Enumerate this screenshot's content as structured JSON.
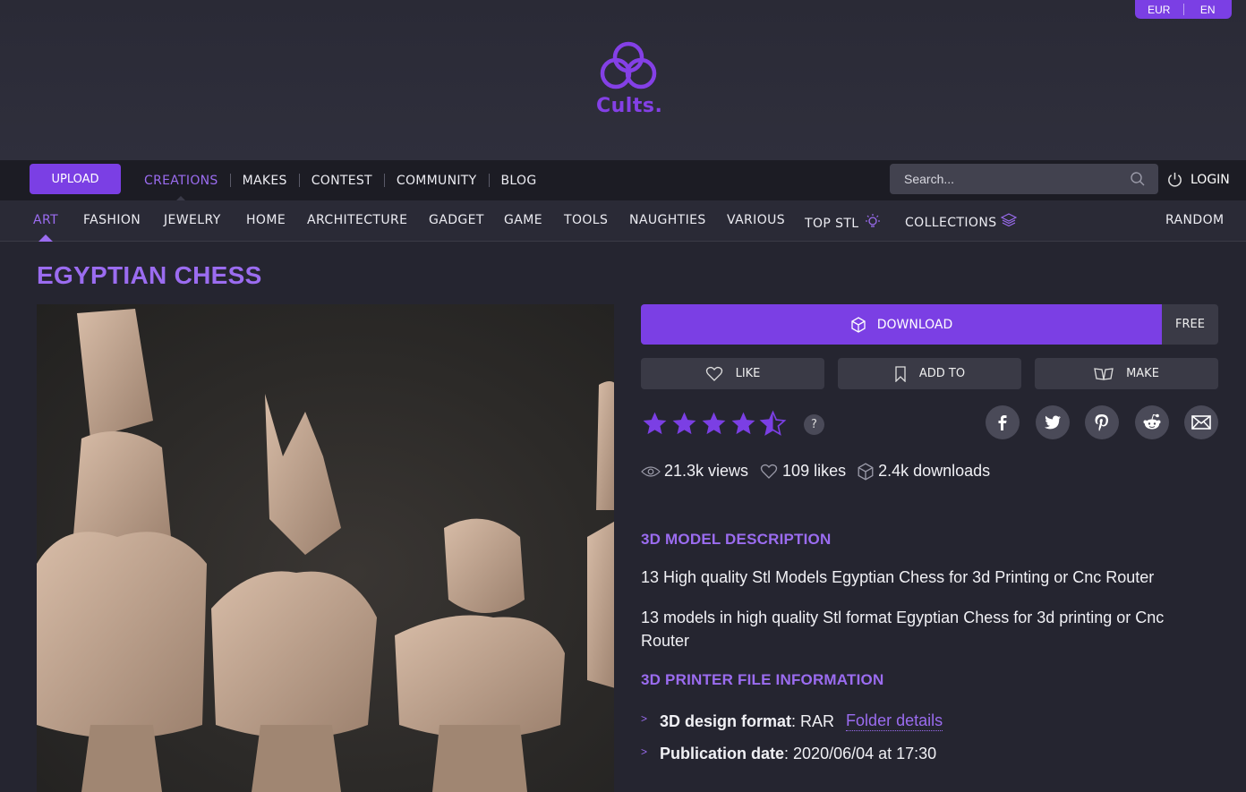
{
  "header": {
    "currency": "EUR",
    "language": "EN",
    "logo_text": "Cults."
  },
  "nav": {
    "upload": "UPLOAD",
    "links": [
      "CREATIONS",
      "MAKES",
      "CONTEST",
      "COMMUNITY",
      "BLOG"
    ],
    "active": "CREATIONS",
    "search_placeholder": "Search...",
    "login": "LOGIN"
  },
  "categories": {
    "items": [
      "ART",
      "FASHION",
      "JEWELRY",
      "HOME",
      "ARCHITECTURE",
      "GADGET",
      "GAME",
      "TOOLS",
      "NAUGHTIES",
      "VARIOUS",
      "TOP STL",
      "COLLECTIONS"
    ],
    "active": "ART",
    "random": "RANDOM"
  },
  "product": {
    "title": "EGYPTIAN CHESS",
    "download": "DOWNLOAD",
    "price": "FREE",
    "like": "LIKE",
    "add_to": "ADD TO",
    "make": "MAKE",
    "rating": 4.5,
    "rating_max": 5,
    "help": "?",
    "stats": {
      "views": "21.3k views",
      "likes": "109 likes",
      "downloads": "2.4k downloads"
    },
    "social_icons": [
      "facebook-icon",
      "twitter-icon",
      "pinterest-icon",
      "reddit-icon",
      "email-icon"
    ],
    "description_heading": "3D MODEL DESCRIPTION",
    "description_1": "13 High quality Stl Models Egyptian Chess for 3d Printing or Cnc Router",
    "description_2": "13 models in high quality Stl format Egyptian Chess for 3d printing or Cnc Router",
    "file_info_heading": "3D PRINTER FILE INFORMATION",
    "format_label": "3D design format",
    "format_value": ": RAR",
    "folder_details": "Folder details",
    "pub_label": "Publication date",
    "pub_value": ": 2020/06/04 at 17:30"
  },
  "colors": {
    "accent": "#7b3fe4",
    "accent_text": "#9b6cf0",
    "background": "#252530"
  }
}
